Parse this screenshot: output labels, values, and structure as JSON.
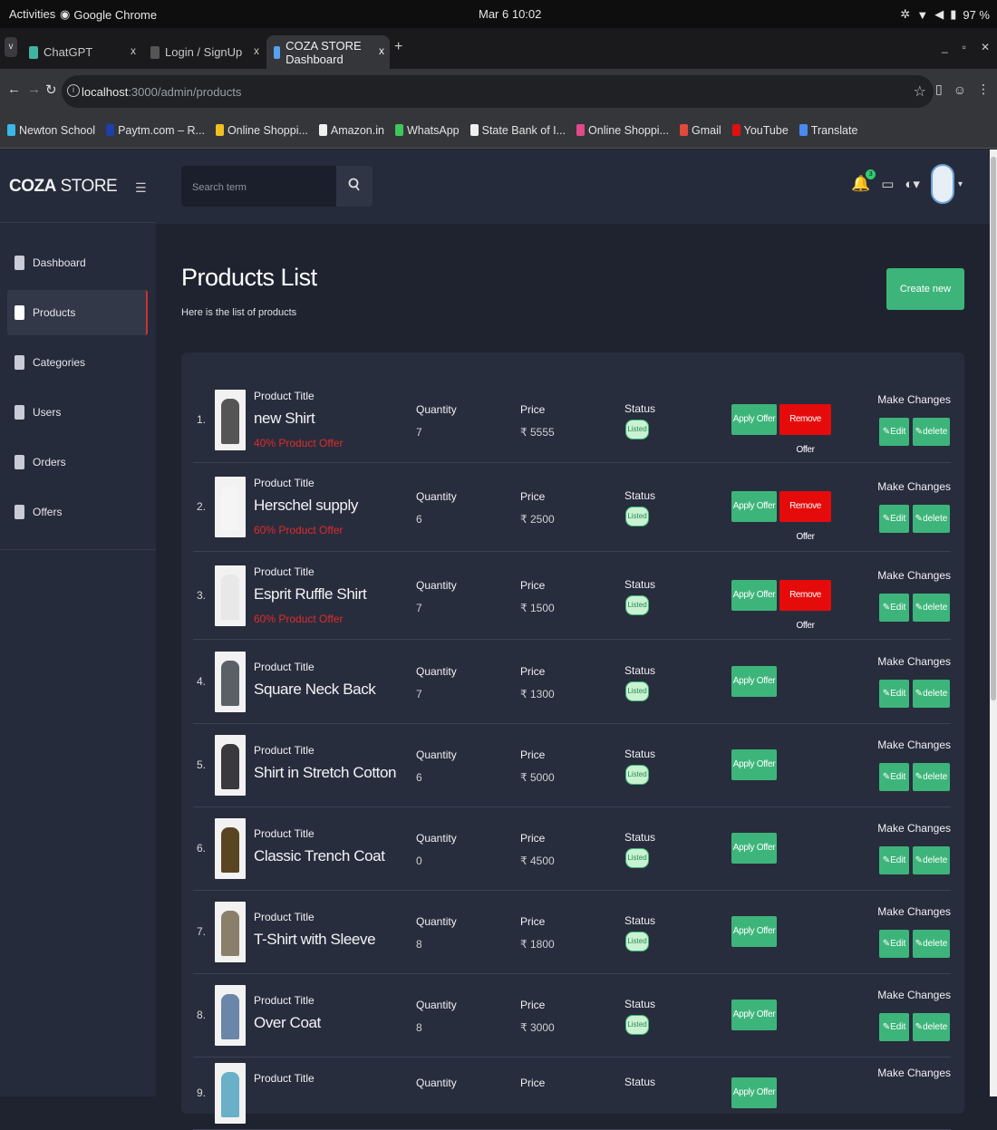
{
  "os": {
    "activities": "Activities",
    "app": "Google Chrome",
    "clock": "Mar 6  10:02",
    "battery": "97 %"
  },
  "tabs": [
    {
      "label": "ChatGPT",
      "close": "x"
    },
    {
      "label": "Login / SignUp",
      "close": "x"
    },
    {
      "label": "COZA STORE Dashboard",
      "close": "x"
    }
  ],
  "address": {
    "host": "localhost",
    "path": ":3000/admin/products"
  },
  "bookmarks": [
    {
      "label": "Newton School",
      "color": "#39b8e8"
    },
    {
      "label": "Paytm.com – R...",
      "color": "#1e3ea8"
    },
    {
      "label": "Online Shoppi...",
      "color": "#f0c020"
    },
    {
      "label": "Amazon.in",
      "color": "#f0f0f0"
    },
    {
      "label": "WhatsApp",
      "color": "#3ec75a"
    },
    {
      "label": "State Bank of I...",
      "color": "#f0f0f0"
    },
    {
      "label": "Online Shoppi...",
      "color": "#e04a8a"
    },
    {
      "label": "Gmail",
      "color": "#e04a3a"
    },
    {
      "label": "YouTube",
      "color": "#e01010"
    },
    {
      "label": "Translate",
      "color": "#4a8af0"
    }
  ],
  "brand": {
    "bold": "COZA",
    "rest": " STORE"
  },
  "sidebar": {
    "items": [
      "Dashboard",
      "Products",
      "Categories",
      "Users",
      "Orders",
      "Offers"
    ],
    "active": "Products"
  },
  "search": {
    "placeholder": "Search term"
  },
  "notifications": {
    "count": "3"
  },
  "header": {
    "title": "Products List",
    "subtitle": "Here is the list of products",
    "create": "Create new"
  },
  "labels": {
    "product_title": "Product Title",
    "quantity": "Quantity",
    "price": "Price",
    "status": "Status",
    "make_changes": "Make Changes",
    "apply_offer": "Apply Offer",
    "remove_offer": "Remove Offer",
    "edit": "Edit",
    "delete": "delete"
  },
  "products": [
    {
      "index": "1.",
      "name": "new Shirt",
      "offer": "40% Product Offer",
      "quantity": "7",
      "price": "₹ 5555",
      "status": "Listed",
      "has_offer": true,
      "thumb": "#555"
    },
    {
      "index": "2.",
      "name": "Herschel supply",
      "offer": "60% Product Offer",
      "quantity": "6",
      "price": "₹ 2500",
      "status": "Listed",
      "has_offer": true,
      "thumb": "#f5f5f5"
    },
    {
      "index": "3.",
      "name": "Esprit Ruffle Shirt",
      "offer": "60% Product Offer",
      "quantity": "7",
      "price": "₹ 1500",
      "status": "Listed",
      "has_offer": true,
      "thumb": "#e8e8e8"
    },
    {
      "index": "4.",
      "name": "Square Neck Back",
      "offer": "",
      "quantity": "7",
      "price": "₹ 1300",
      "status": "Listed",
      "has_offer": false,
      "thumb": "#5a6068"
    },
    {
      "index": "5.",
      "name": "Shirt in Stretch Cotton",
      "offer": "",
      "quantity": "6",
      "price": "₹ 5000",
      "status": "Listed",
      "has_offer": false,
      "thumb": "#3a3a3e"
    },
    {
      "index": "6.",
      "name": "Classic Trench Coat",
      "offer": "",
      "quantity": "0",
      "price": "₹ 4500",
      "status": "Listed",
      "has_offer": false,
      "thumb": "#5a4522"
    },
    {
      "index": "7.",
      "name": "T-Shirt with Sleeve",
      "offer": "",
      "quantity": "8",
      "price": "₹ 1800",
      "status": "Listed",
      "has_offer": false,
      "thumb": "#8a7f6a"
    },
    {
      "index": "8.",
      "name": "Over Coat",
      "offer": "",
      "quantity": "8",
      "price": "₹ 3000",
      "status": "Listed",
      "has_offer": false,
      "thumb": "#6a86a8"
    },
    {
      "index": "9.",
      "name": "",
      "offer": "",
      "quantity": "",
      "price": "",
      "status": "",
      "has_offer": false,
      "thumb": "#6ab0c8"
    }
  ],
  "colors": {
    "accent": "#3db57a",
    "danger": "#e60b0b",
    "bg": "#1f2330",
    "panel": "#282d3d"
  }
}
